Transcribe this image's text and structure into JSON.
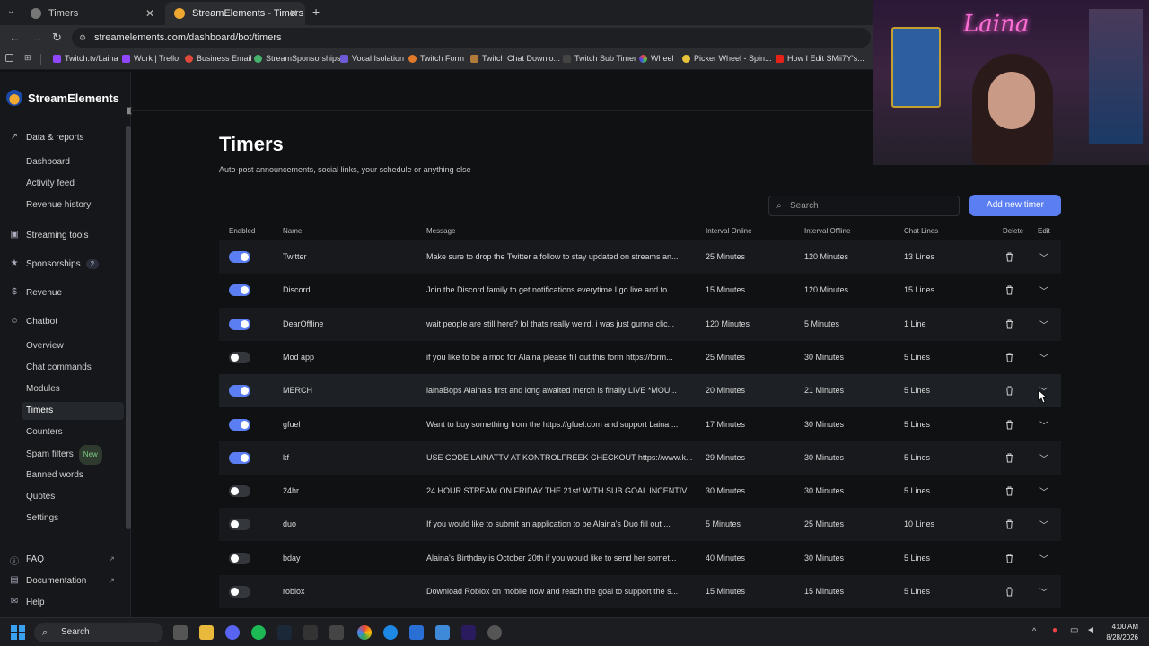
{
  "browser": {
    "tabs": [
      {
        "label": "Timers"
      },
      {
        "label": "StreamElements - Timers"
      }
    ],
    "url": "streamelements.com/dashboard/bot/timers",
    "bookmarks": [
      "Twitch.tv/Laina",
      "Work | Trello",
      "Business Email",
      "StreamSponsorships",
      "Vocal Isolation",
      "Twitch Form",
      "Twitch Chat Downlo...",
      "Twitch Sub Timer",
      "Wheel",
      "Picker Wheel - Spin...",
      "How I Edit SMii7Y's..."
    ]
  },
  "brand": "StreamElements",
  "sidebar": {
    "sections": [
      {
        "label": "Data & reports",
        "icon": "chart-icon"
      },
      {
        "label": "Streaming tools",
        "icon": "video-icon"
      },
      {
        "label": "Sponsorships",
        "icon": "star-icon",
        "badge": "2"
      },
      {
        "label": "Revenue",
        "icon": "dollar-icon"
      },
      {
        "label": "Chatbot",
        "icon": "robot-icon"
      }
    ],
    "data_items": [
      "Dashboard",
      "Activity feed",
      "Revenue history"
    ],
    "chatbot_items": [
      "Overview",
      "Chat commands",
      "Modules",
      "Timers",
      "Counters",
      "Spam filters",
      "Banned words",
      "Quotes",
      "Settings"
    ],
    "spam_badge": "New",
    "footer": [
      "FAQ",
      "Documentation",
      "Help"
    ]
  },
  "page": {
    "title": "Timers",
    "subtitle": "Auto-post announcements, social links, your schedule or anything else",
    "search_placeholder": "Search",
    "add_button": "Add new timer"
  },
  "table": {
    "headers": {
      "enabled": "Enabled",
      "name": "Name",
      "message": "Message",
      "interval_online": "Interval Online",
      "interval_offline": "Interval Offline",
      "chat_lines": "Chat Lines",
      "delete": "Delete",
      "edit": "Edit"
    },
    "rows": [
      {
        "enabled": true,
        "name": "Twitter",
        "message": "Make sure to drop the Twitter a follow to stay updated on streams an...",
        "online": "25 Minutes",
        "offline": "120 Minutes",
        "lines": "13 Lines"
      },
      {
        "enabled": true,
        "name": "Discord",
        "message": "Join the Discord family to get notifications everytime I go live and to ...",
        "online": "15 Minutes",
        "offline": "120 Minutes",
        "lines": "15 Lines"
      },
      {
        "enabled": true,
        "name": "DearOffline",
        "message": "wait people are still here? lol thats really weird. i was just gunna clic...",
        "online": "120 Minutes",
        "offline": "5 Minutes",
        "lines": "1 Line"
      },
      {
        "enabled": false,
        "name": "Mod app",
        "message": "if you like to be a mod for Alaina please fill out this form https://form...",
        "online": "25 Minutes",
        "offline": "30 Minutes",
        "lines": "5 Lines"
      },
      {
        "enabled": true,
        "name": "MERCH",
        "message": "lainaBops Alaina's first and long awaited merch is finally LIVE *MOU...",
        "online": "20 Minutes",
        "offline": "21 Minutes",
        "lines": "5 Lines"
      },
      {
        "enabled": true,
        "name": "gfuel",
        "message": "Want to buy something from the https://gfuel.com and support Laina ...",
        "online": "17 Minutes",
        "offline": "30 Minutes",
        "lines": "5 Lines"
      },
      {
        "enabled": true,
        "name": "kf",
        "message": "USE CODE LAINATTV AT KONTROLFREEK CHECKOUT https://www.k...",
        "online": "29 Minutes",
        "offline": "30 Minutes",
        "lines": "5 Lines"
      },
      {
        "enabled": false,
        "name": "24hr",
        "message": "24 HOUR STREAM ON FRIDAY THE 21st! WITH SUB GOAL INCENTIV...",
        "online": "30 Minutes",
        "offline": "30 Minutes",
        "lines": "5 Lines"
      },
      {
        "enabled": false,
        "name": "duo",
        "message": "If you would like to submit an application to be Alaina's Duo fill out ...",
        "online": "5 Minutes",
        "offline": "25 Minutes",
        "lines": "10 Lines"
      },
      {
        "enabled": false,
        "name": "bday",
        "message": "Alaina's Birthday is October 20th if you would like to send her somet...",
        "online": "40 Minutes",
        "offline": "30 Minutes",
        "lines": "5 Lines"
      },
      {
        "enabled": false,
        "name": "roblox",
        "message": "Download Roblox on mobile now and reach the goal to support the s...",
        "online": "15 Minutes",
        "offline": "15 Minutes",
        "lines": "5 Lines"
      }
    ]
  },
  "webcam": {
    "neon_sign": "Laina"
  },
  "taskbar": {
    "search_label": "Search",
    "time": "4:00 AM",
    "date": "8/28/2026"
  },
  "colors": {
    "accent": "#5b7ff2",
    "background": "#0f1113",
    "neon": "#ff6fd8"
  }
}
